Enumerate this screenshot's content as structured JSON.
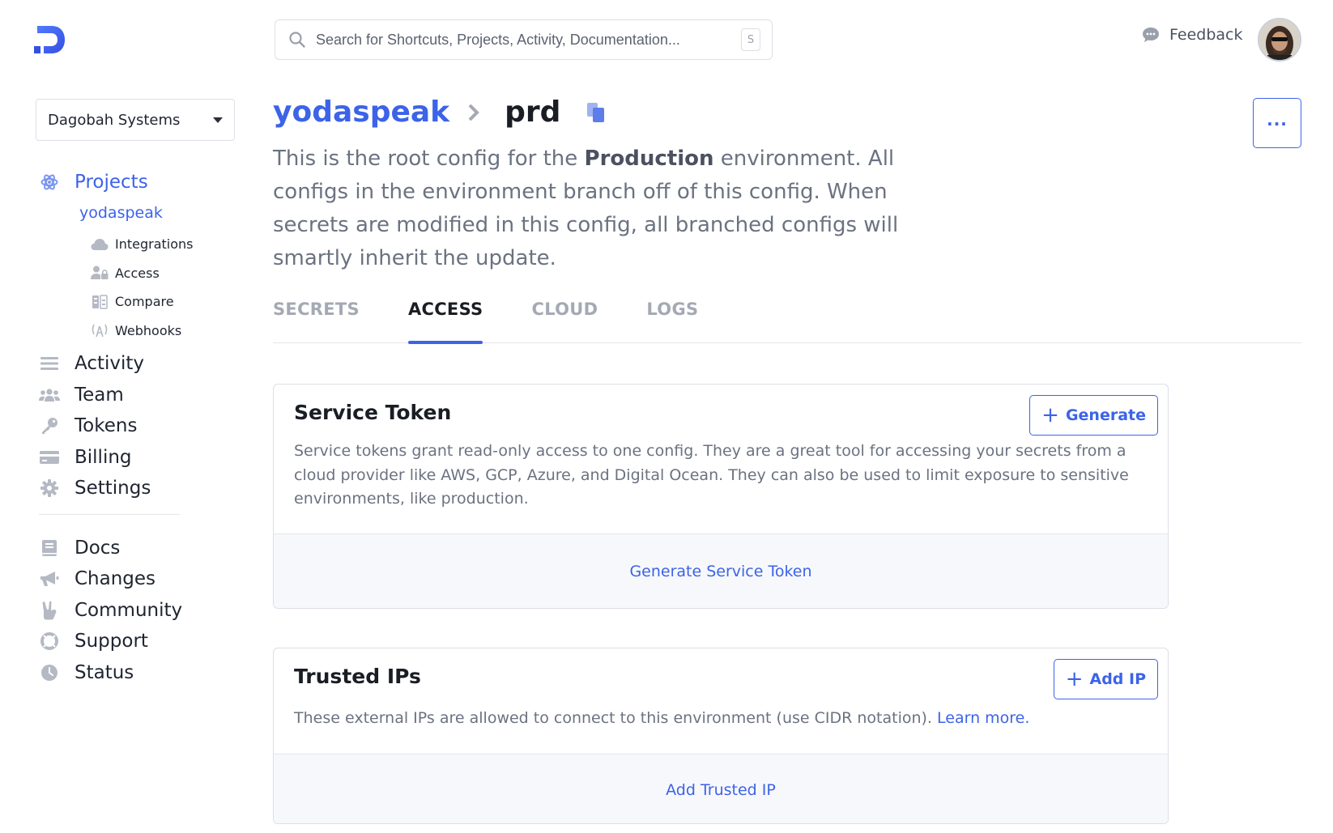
{
  "search": {
    "placeholder": "Search for Shortcuts, Projects, Activity, Documentation...",
    "shortcut": "S"
  },
  "header": {
    "feedback_label": "Feedback"
  },
  "org": {
    "name": "Dagobah Systems"
  },
  "sidebar": {
    "projects_label": "Projects",
    "project_name": "yodaspeak",
    "project_items": [
      {
        "label": "Integrations",
        "icon": "cloud-icon"
      },
      {
        "label": "Access",
        "icon": "users-lock-icon"
      },
      {
        "label": "Compare",
        "icon": "compare-icon"
      },
      {
        "label": "Webhooks",
        "icon": "broadcast-icon"
      }
    ],
    "main_items": [
      {
        "label": "Activity",
        "icon": "list-icon"
      },
      {
        "label": "Team",
        "icon": "team-icon"
      },
      {
        "label": "Tokens",
        "icon": "key-icon"
      },
      {
        "label": "Billing",
        "icon": "credit-card-icon"
      },
      {
        "label": "Settings",
        "icon": "gear-icon"
      }
    ],
    "resource_items": [
      {
        "label": "Docs",
        "icon": "book-icon"
      },
      {
        "label": "Changes",
        "icon": "megaphone-icon"
      },
      {
        "label": "Community",
        "icon": "peace-hand-icon"
      },
      {
        "label": "Support",
        "icon": "lifebuoy-icon"
      },
      {
        "label": "Status",
        "icon": "clock-icon"
      }
    ]
  },
  "page": {
    "project": "yodaspeak",
    "config": "prd",
    "description_pre": "This is the root config for the ",
    "description_bold": "Production",
    "description_post": " environment. All configs in the environment branch off of this config. When secrets are modified in this config, all branched configs will smartly inherit the update."
  },
  "tabs": [
    {
      "label": "SECRETS",
      "active": false
    },
    {
      "label": "ACCESS",
      "active": true
    },
    {
      "label": "CLOUD",
      "active": false
    },
    {
      "label": "LOGS",
      "active": false
    }
  ],
  "service_token": {
    "title": "Service Token",
    "button": "Generate",
    "description": "Service tokens grant read-only access to one config. They are a great tool for accessing your secrets from a cloud provider like AWS, GCP, Azure, and Digital Ocean. They can also be used to limit exposure to sensitive environments, like production.",
    "footer_link": "Generate Service Token"
  },
  "trusted_ips": {
    "title": "Trusted IPs",
    "button": "Add IP",
    "description": "These external IPs are allowed to connect to this environment (use CIDR notation).",
    "learn_more": "Learn more.",
    "footer_link": "Add Trusted IP"
  },
  "colors": {
    "accent": "#3c63e8",
    "text": "#1f2430",
    "muted": "#6b7280",
    "icon_gray": "#b4b9c3"
  }
}
